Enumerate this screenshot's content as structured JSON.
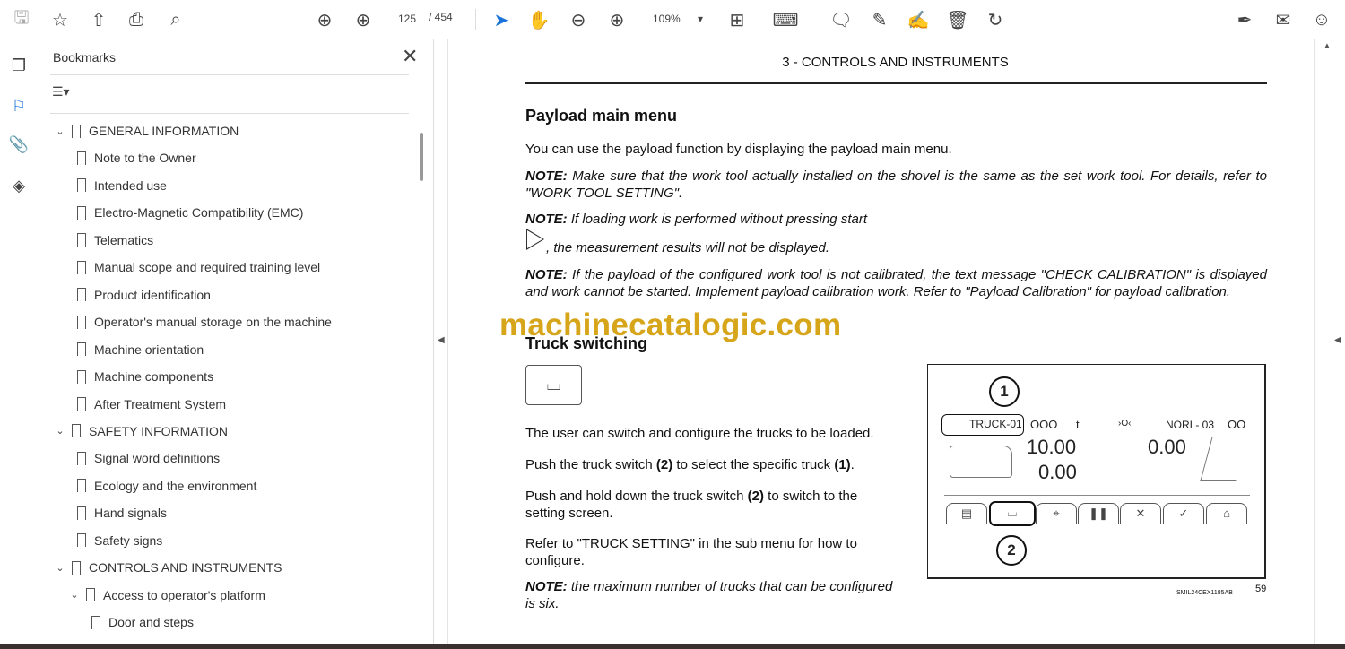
{
  "toolbar": {
    "current_page": "125",
    "page_total": "/ 454",
    "zoom": "109%",
    "zoom_caret": "▾"
  },
  "bookmarks_panel": {
    "title": "Bookmarks",
    "close": "✕",
    "options": "☰▾",
    "items": [
      {
        "label": "GENERAL INFORMATION",
        "level": 0,
        "expanded": true
      },
      {
        "label": "Note to the Owner",
        "level": 1
      },
      {
        "label": "Intended use",
        "level": 1
      },
      {
        "label": "Electro-Magnetic Compatibility (EMC)",
        "level": 1
      },
      {
        "label": "Telematics",
        "level": 1
      },
      {
        "label": "Manual scope and required training level",
        "level": 1
      },
      {
        "label": "Product identification",
        "level": 1
      },
      {
        "label": "Operator's manual storage on the machine",
        "level": 1
      },
      {
        "label": "Machine orientation",
        "level": 1
      },
      {
        "label": "Machine components",
        "level": 1
      },
      {
        "label": "After Treatment System",
        "level": 1
      },
      {
        "label": "SAFETY INFORMATION",
        "level": 0,
        "expanded": true
      },
      {
        "label": "Signal word definitions",
        "level": 1
      },
      {
        "label": "Ecology and the environment",
        "level": 1
      },
      {
        "label": "Hand signals",
        "level": 1
      },
      {
        "label": "Safety signs",
        "level": 1
      },
      {
        "label": "CONTROLS AND INSTRUMENTS",
        "level": 0,
        "expanded": true
      },
      {
        "label": "Access to operator's platform",
        "level": 1,
        "expanded": true
      },
      {
        "label": "Door and steps",
        "level": 2
      }
    ]
  },
  "page": {
    "header": "3 - CONTROLS AND INSTRUMENTS",
    "h1": "Payload main menu",
    "p1": "You can use the payload function by displaying the payload main menu.",
    "note_label": "NOTE:",
    "note1": " Make sure that the work tool actually installed on the shovel is the same as the set work tool. For details, refer to \"WORK TOOL SETTING\".",
    "note2a": " If loading work is performed without pressing start",
    "note2b": ", the measurement results will not be displayed.",
    "note3": " If the payload of the configured work tool is not calibrated, the text message \"CHECK CALIBRATION\" is displayed and work cannot be started. Implement payload calibration work. Refer to \"Payload Calibration\" for payload calibration.",
    "watermark": "machinecatalogic.com",
    "h2": "Truck switching",
    "p2": "The user can switch and configure the trucks to be loaded.",
    "p3a": "Push the truck switch ",
    "p3b": "(2)",
    "p3c": " to select the specific truck ",
    "p3d": "(1)",
    "p3e": ".",
    "p4a": "Push and hold down the truck switch ",
    "p4b": "(2)",
    "p4c": " to switch to the setting screen.",
    "p5": "Refer to \"TRUCK SETTING\" in the sub menu for how to configure.",
    "note4": " the maximum number of trucks that can be configured is six.",
    "figure": {
      "callout1": "1",
      "callout2": "2",
      "truck": "TRUCK-01",
      "ooo": "OOO",
      "unit": "t",
      "link": "›O‹",
      "tool": "NORI - 03",
      "oo": "OO",
      "target": "10.00",
      "loaded": "0.00",
      "bucket": "0.00",
      "code": "SMIL24CEX1185AB",
      "page_no": "59"
    }
  }
}
